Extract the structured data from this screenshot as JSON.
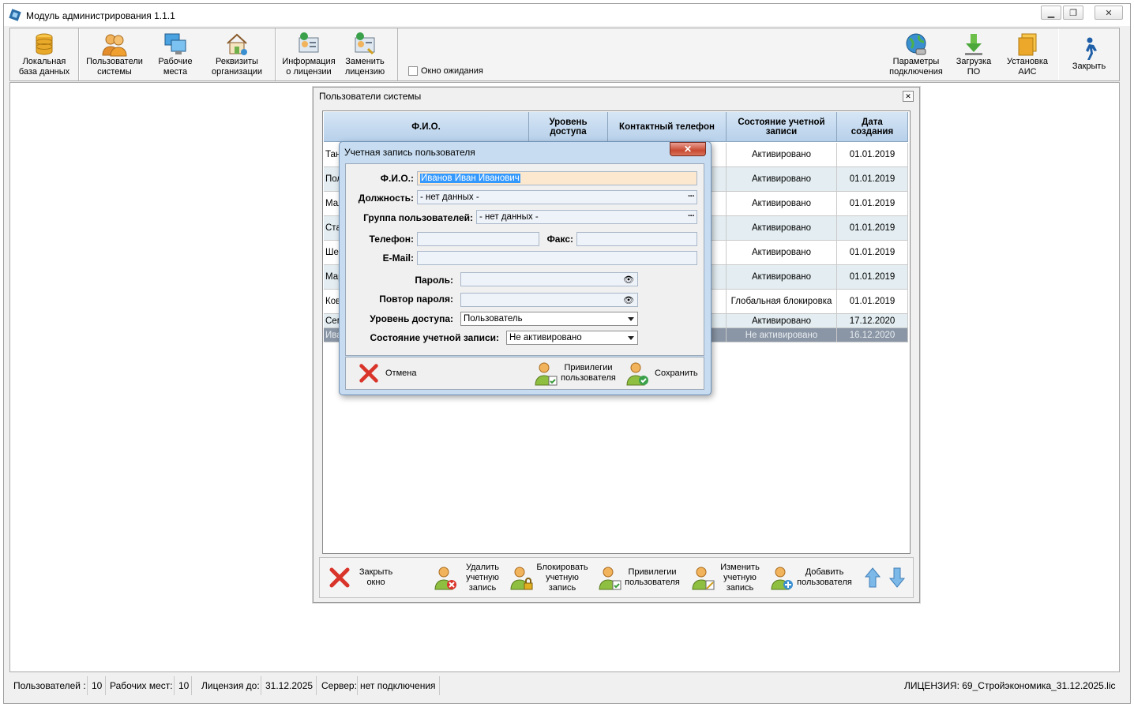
{
  "window": {
    "title": "Модуль администрирования 1.1.1"
  },
  "toolbar": {
    "buttons": [
      {
        "label": "Локальная\nбаза данных",
        "icon": "database-icon"
      },
      {
        "label": "Пользователи\nсистемы",
        "icon": "users-icon"
      },
      {
        "label": "Рабочие\nместа",
        "icon": "workstations-icon"
      },
      {
        "label": "Реквизиты\nорганизации",
        "icon": "organization-house-icon"
      },
      {
        "label": "Информация\nо лицензии",
        "icon": "license-info-icon"
      },
      {
        "label": "Заменить\nлицензию",
        "icon": "replace-license-icon"
      },
      {
        "label": "Параметры\nподключения",
        "icon": "globe-connection-icon"
      },
      {
        "label": "Загрузка\nПО",
        "icon": "download-arrow-icon"
      },
      {
        "label": "Установка\nАИС",
        "icon": "install-folders-icon"
      },
      {
        "label": "Закрыть",
        "icon": "walking-man-icon"
      }
    ],
    "wait_window_label": "Окно ожидания",
    "wait_window_checked": false
  },
  "users_window": {
    "title": "Пользователи системы",
    "columns": [
      "Ф.И.О.",
      "Уровень\nдоступа",
      "Контактный телефон",
      "Состояние учетной\nзаписи",
      "Дата\nсоздания"
    ],
    "rows": [
      {
        "fio": "Тан",
        "level": "",
        "phone": "",
        "status": "Активировано",
        "date": "01.01.2019"
      },
      {
        "fio": "Пол",
        "level": "",
        "phone": "",
        "status": "Активировано",
        "date": "01.01.2019"
      },
      {
        "fio": "Мал",
        "level": "",
        "phone": "",
        "status": "Активировано",
        "date": "01.01.2019"
      },
      {
        "fio": "Ста",
        "level": "",
        "phone": "",
        "status": "Активировано",
        "date": "01.01.2019"
      },
      {
        "fio": "Шев",
        "level": "",
        "phone": "",
        "status": "Активировано",
        "date": "01.01.2019"
      },
      {
        "fio": "Мар",
        "level": "",
        "phone": "",
        "status": "Активировано",
        "date": "01.01.2019"
      },
      {
        "fio": "Ков",
        "level": "",
        "phone": "",
        "status": "Глобальная блокировка",
        "date": "01.01.2019"
      },
      {
        "fio": "Сем",
        "level": "",
        "phone": "",
        "status": "Активировано",
        "date": "17.12.2020"
      },
      {
        "fio": "Ива",
        "level": "",
        "phone": "",
        "status": "Не активировано",
        "date": "16.12.2020"
      }
    ],
    "bottom_buttons": [
      {
        "label": "Закрыть\nокно",
        "icon": "red-x-icon"
      },
      {
        "label": "Удалить\nучетную\nзапись",
        "icon": "user-delete-icon"
      },
      {
        "label": "Блокировать\nучетную\nзапись",
        "icon": "user-lock-icon"
      },
      {
        "label": "Привилегии\nпользователя",
        "icon": "user-privileges-icon"
      },
      {
        "label": "Изменить\nучетную\nзапись",
        "icon": "user-edit-icon"
      },
      {
        "label": "Добавить\nпользователя",
        "icon": "user-add-icon"
      }
    ],
    "up_icon": "arrow-up-icon",
    "down_icon": "arrow-down-icon"
  },
  "dialog": {
    "title": "Учетная запись пользователя",
    "close_symbol": "✕",
    "fio_label": "Ф.И.О.:",
    "fio_value": "Иванов Иван Иванович",
    "position_label": "Должность:",
    "position_value": "- нет данных -",
    "group_label": "Группа пользователей:",
    "group_value": "- нет данных -",
    "ellipsis": "···",
    "phone_label": "Телефон:",
    "phone_value": "",
    "fax_label": "Факс:",
    "fax_value": "",
    "email_label": "E-Mail:",
    "email_value": "",
    "password_label": "Пароль:",
    "password_value": "",
    "password_repeat_label": "Повтор пароля:",
    "password_repeat_value": "",
    "access_label": "Уровень доступа:",
    "access_value": "Пользователь",
    "status_label": "Состояние учетной записи:",
    "status_value": "Не активировано",
    "cancel_label": "Отмена",
    "privileges_label": "Привилегии\nпользователя",
    "save_label": "Сохранить"
  },
  "statusbar": {
    "users_label": "Пользователей :",
    "users_count": "10",
    "workplaces_label": "Рабочих мест:",
    "workplaces_count": "10",
    "license_until_label": "Лицензия до:",
    "license_until": "31.12.2025",
    "server_label": "Сервер:",
    "server_value": "нет подключения",
    "license_file": "ЛИЦЕНЗИЯ: 69_Стройэкономика_31.12.2025.lic"
  }
}
